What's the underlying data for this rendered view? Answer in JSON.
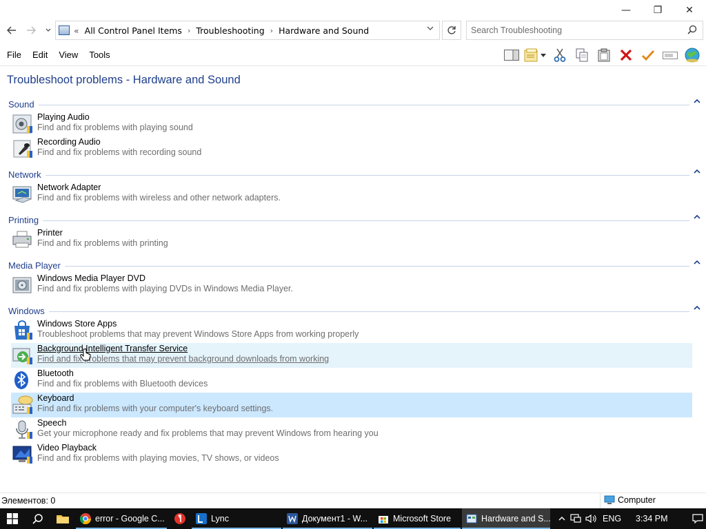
{
  "window": {
    "minimize": "—",
    "maximize": "❐",
    "close": "✕"
  },
  "address": {
    "overflow": "«",
    "segments": [
      "All Control Panel Items",
      "Troubleshooting",
      "Hardware and Sound"
    ],
    "separator": "›"
  },
  "search": {
    "placeholder": "Search Troubleshooting"
  },
  "menu": {
    "file": "File",
    "edit": "Edit",
    "view": "View",
    "tools": "Tools"
  },
  "page_title": "Troubleshoot problems - Hardware and Sound",
  "groups": {
    "sound": {
      "title": "Sound",
      "items": [
        {
          "name": "Playing Audio",
          "desc": "Find and fix problems with playing sound"
        },
        {
          "name": "Recording Audio",
          "desc": "Find and fix problems with recording sound"
        }
      ]
    },
    "network": {
      "title": "Network",
      "items": [
        {
          "name": "Network Adapter",
          "desc": "Find and fix problems with wireless and other network adapters."
        }
      ]
    },
    "printing": {
      "title": "Printing",
      "items": [
        {
          "name": "Printer",
          "desc": "Find and fix problems with printing"
        }
      ]
    },
    "media": {
      "title": "Media Player",
      "items": [
        {
          "name": "Windows Media Player DVD",
          "desc": "Find and fix problems with playing DVDs in Windows Media Player."
        }
      ]
    },
    "windows": {
      "title": "Windows",
      "items": [
        {
          "name": "Windows Store Apps",
          "desc": "Troubleshoot problems that may prevent Windows Store Apps from working properly"
        },
        {
          "name": "Background Intelligent Transfer Service",
          "desc": "Find and fix problems that may prevent background downloads from working"
        },
        {
          "name": "Bluetooth",
          "desc": "Find and fix problems with Bluetooth devices"
        },
        {
          "name": "Keyboard",
          "desc": "Find and fix problems with your computer's keyboard settings."
        },
        {
          "name": "Speech",
          "desc": "Get your microphone ready and fix problems that may prevent Windows from hearing you"
        },
        {
          "name": "Video Playback",
          "desc": "Find and fix problems with playing movies, TV shows, or videos"
        }
      ]
    }
  },
  "status": {
    "count": "Элементов: 0",
    "zone": "Computer"
  },
  "taskbar": {
    "apps": [
      {
        "label": "error - Google C..."
      },
      {
        "label": "Lync"
      },
      {
        "label": "Документ1 - W..."
      },
      {
        "label": "Microsoft Store"
      },
      {
        "label": "Hardware and S..."
      }
    ],
    "language": "ENG",
    "time": "3:34 PM"
  },
  "colors": {
    "accent": "#1e3e8c",
    "hover_row": "#e5f3fb",
    "selected_row": "#cce8ff",
    "taskbar": "#101010"
  }
}
